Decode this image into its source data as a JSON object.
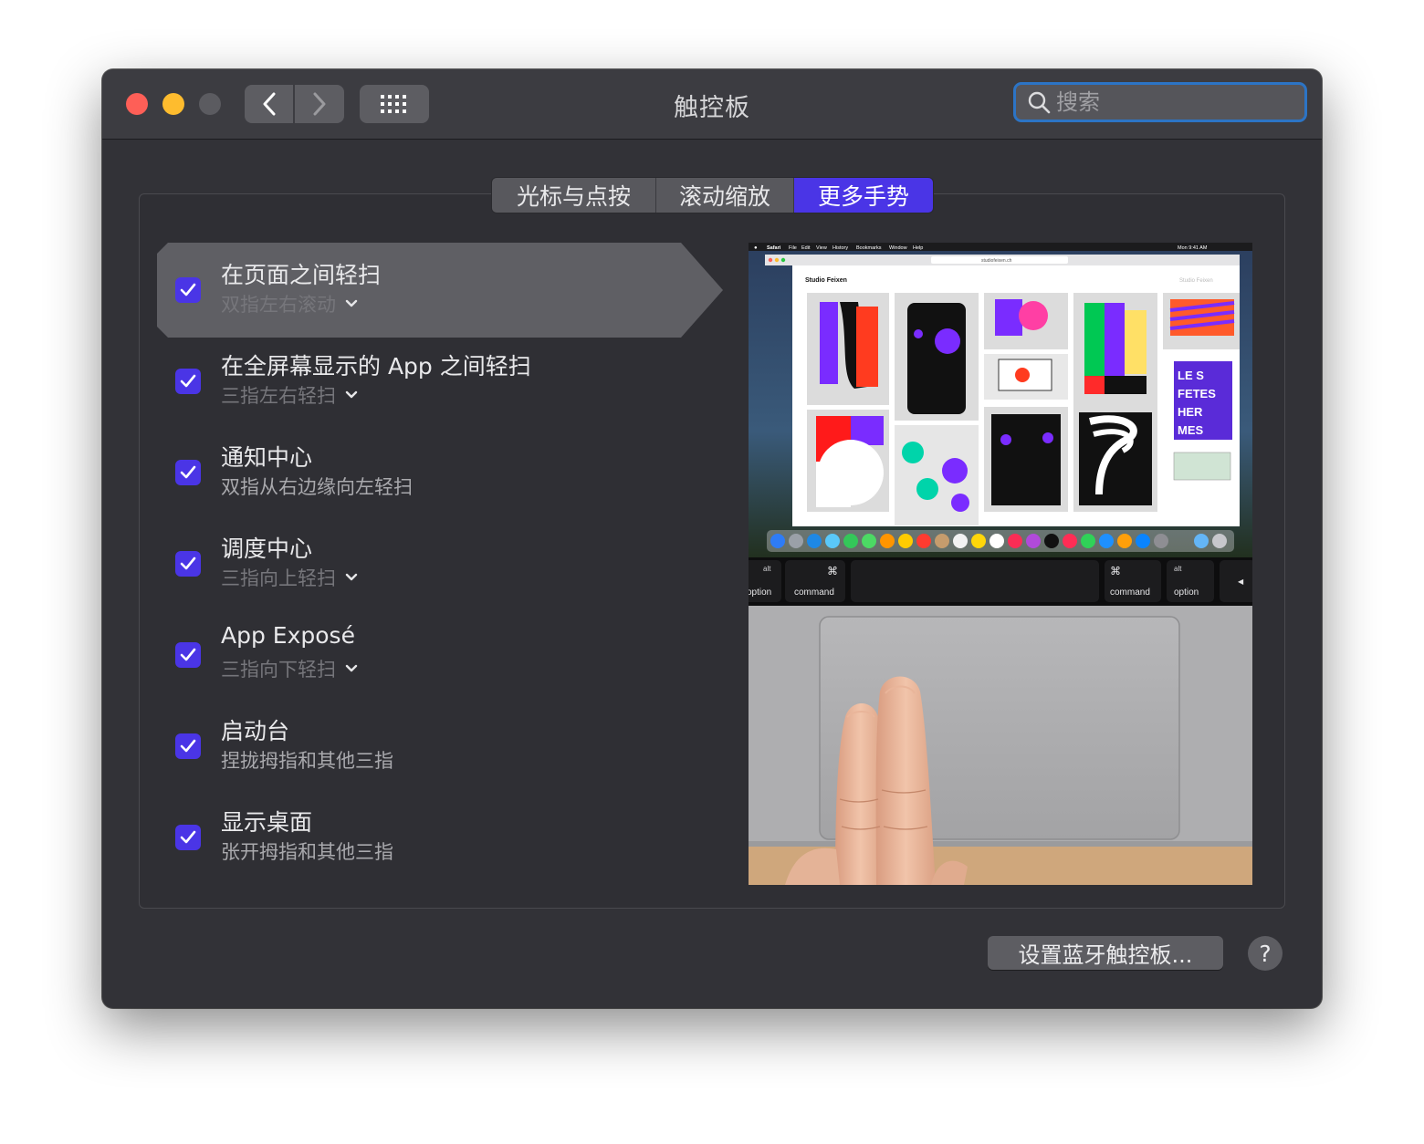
{
  "window": {
    "title": "触控板",
    "search": {
      "placeholder": "搜索",
      "value": ""
    }
  },
  "tabs": [
    {
      "label": "光标与点按",
      "selected": false
    },
    {
      "label": "滚动缩放",
      "selected": false
    },
    {
      "label": "更多手势",
      "selected": true
    }
  ],
  "gestures": [
    {
      "title": "在页面之间轻扫",
      "subtitle": "双指左右滚动",
      "checked": true,
      "has_dropdown": true,
      "selected": true
    },
    {
      "title": "在全屏幕显示的 App 之间轻扫",
      "subtitle": "三指左右轻扫",
      "checked": true,
      "has_dropdown": true,
      "selected": false
    },
    {
      "title": "通知中心",
      "subtitle": "双指从右边缘向左轻扫",
      "checked": true,
      "has_dropdown": false,
      "selected": false
    },
    {
      "title": "调度中心",
      "subtitle": "三指向上轻扫",
      "checked": true,
      "has_dropdown": true,
      "selected": false
    },
    {
      "title": "App Exposé",
      "subtitle": "三指向下轻扫",
      "checked": true,
      "has_dropdown": true,
      "selected": false
    },
    {
      "title": "启动台",
      "subtitle": "捏拢拇指和其他三指",
      "checked": true,
      "has_dropdown": false,
      "selected": false
    },
    {
      "title": "显示桌面",
      "subtitle": "张开拇指和其他三指",
      "checked": true,
      "has_dropdown": false,
      "selected": false
    }
  ],
  "preview": {
    "menubar": [
      "Safari",
      "File",
      "Edit",
      "View",
      "History",
      "Bookmarks",
      "Window",
      "Help"
    ],
    "clock": "Mon 9:41 AM",
    "site_title": "Studio Feixen",
    "url": "studiofeixen.ch",
    "keys": {
      "left_alt": "alt",
      "left_option": "option",
      "left_cmd_symbol": "⌘",
      "left_command": "command",
      "right_cmd_symbol": "⌘",
      "right_command": "command",
      "right_alt": "alt",
      "right_option": "option"
    }
  },
  "footer": {
    "bluetooth_button": "设置蓝牙触控板...",
    "help_button": "?"
  },
  "colors": {
    "accent": "#4a35e6",
    "search_focus": "#2c74c5",
    "close": "#fe5f57",
    "minimize": "#febc2e",
    "window_bg": "#323237"
  }
}
